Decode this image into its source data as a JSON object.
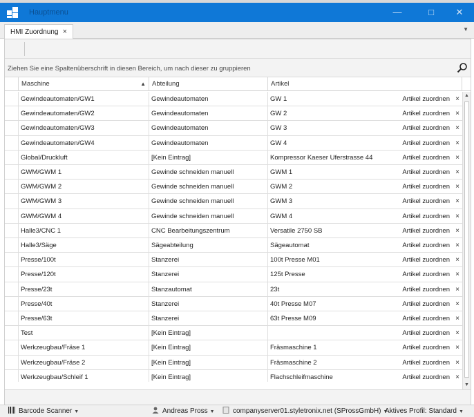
{
  "window": {
    "title": "Hauptmenu"
  },
  "tabs": [
    {
      "label": "HMI Zuordnung"
    }
  ],
  "group_hint": "Ziehen Sie eine Spaltenüberschrift in diesen Bereich, um nach dieser zu gruppieren",
  "columns": {
    "maschine": "Maschine",
    "abteilung": "Abteilung",
    "artikel": "Artikel"
  },
  "assign_label": "Artikel zuordnen",
  "rows": [
    {
      "maschine": "Gewindeautomaten/GW1",
      "abteilung": "Gewindeautomaten",
      "artikel": "GW 1"
    },
    {
      "maschine": "Gewindeautomaten/GW2",
      "abteilung": "Gewindeautomaten",
      "artikel": "GW 2"
    },
    {
      "maschine": "Gewindeautomaten/GW3",
      "abteilung": "Gewindeautomaten",
      "artikel": "GW 3"
    },
    {
      "maschine": "Gewindeautomaten/GW4",
      "abteilung": "Gewindeautomaten",
      "artikel": "GW 4"
    },
    {
      "maschine": "Global/Druckluft",
      "abteilung": "[Kein Eintrag]",
      "artikel": "Kompressor Kaeser Uferstrasse 44"
    },
    {
      "maschine": "GWM/GWM 1",
      "abteilung": "Gewinde schneiden manuell",
      "artikel": "GWM 1"
    },
    {
      "maschine": "GWM/GWM 2",
      "abteilung": "Gewinde schneiden manuell",
      "artikel": "GWM 2"
    },
    {
      "maschine": "GWM/GWM 3",
      "abteilung": "Gewinde schneiden manuell",
      "artikel": "GWM 3"
    },
    {
      "maschine": "GWM/GWM 4",
      "abteilung": "Gewinde schneiden manuell",
      "artikel": "GWM 4"
    },
    {
      "maschine": "Halle3/CNC 1",
      "abteilung": "CNC Bearbeitungszentrum",
      "artikel": "Versatile 2750 SB"
    },
    {
      "maschine": "Halle3/Säge",
      "abteilung": "Sägeabteilung",
      "artikel": "Sägeautomat"
    },
    {
      "maschine": "Presse/100t",
      "abteilung": "Stanzerei",
      "artikel": "100t Presse M01"
    },
    {
      "maschine": "Presse/120t",
      "abteilung": "Stanzerei",
      "artikel": "125t Presse"
    },
    {
      "maschine": "Presse/23t",
      "abteilung": "Stanzautomat",
      "artikel": "23t"
    },
    {
      "maschine": "Presse/40t",
      "abteilung": "Stanzerei",
      "artikel": "40t Presse M07"
    },
    {
      "maschine": "Presse/63t",
      "abteilung": "Stanzerei",
      "artikel": "63t Presse M09"
    },
    {
      "maschine": "Test",
      "abteilung": "[Kein Eintrag]",
      "artikel": ""
    },
    {
      "maschine": "Werkzeugbau/Fräse 1",
      "abteilung": "[Kein Eintrag]",
      "artikel": "Fräsmaschine 1"
    },
    {
      "maschine": "Werkzeugbau/Fräse 2",
      "abteilung": "[Kein Eintrag]",
      "artikel": "Fräsmaschine 2"
    },
    {
      "maschine": "Werkzeugbau/Schleif 1",
      "abteilung": "[Kein Eintrag]",
      "artikel": "Flachschleifmaschine"
    }
  ],
  "statusbar": {
    "barcode": "Barcode Scanner",
    "user": "Andreas Pross",
    "server": "companyserver01.styletronix.net (SProssGmbH)",
    "profile": "Aktives Profil: Standard"
  },
  "colors": {
    "titlebar": "#0f78d7",
    "accent": "#0f78d7"
  },
  "icons": {
    "app": "app-tiles-icon",
    "search": "search-icon",
    "close": "close-icon",
    "user": "user-icon",
    "server": "server-icon",
    "barcode": "barcode-icon"
  }
}
